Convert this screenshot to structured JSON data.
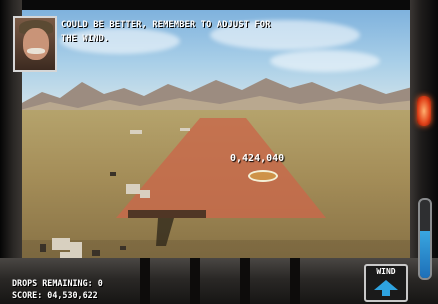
{
  "hud": {
    "message": "COULD BE BETTER, REMEMBER TO ADJUST FOR THE WIND.",
    "popup_score": "0,424,040",
    "drops_remaining": "DROPS REMAINING: 0",
    "score": "SCORE: 04,530,622",
    "wind_label": "WIND"
  },
  "gauge": {
    "level": 0.6
  },
  "icons": {
    "portrait": "commander-portrait",
    "target": "drop-target-icon",
    "wind_arrow": "wind-arrow-icon",
    "warning_light": "warning-light-icon"
  },
  "colors": {
    "drop_zone": "#c8694b",
    "wind_arrow": "#2ea3e0",
    "warning_light": "#e2431a"
  }
}
